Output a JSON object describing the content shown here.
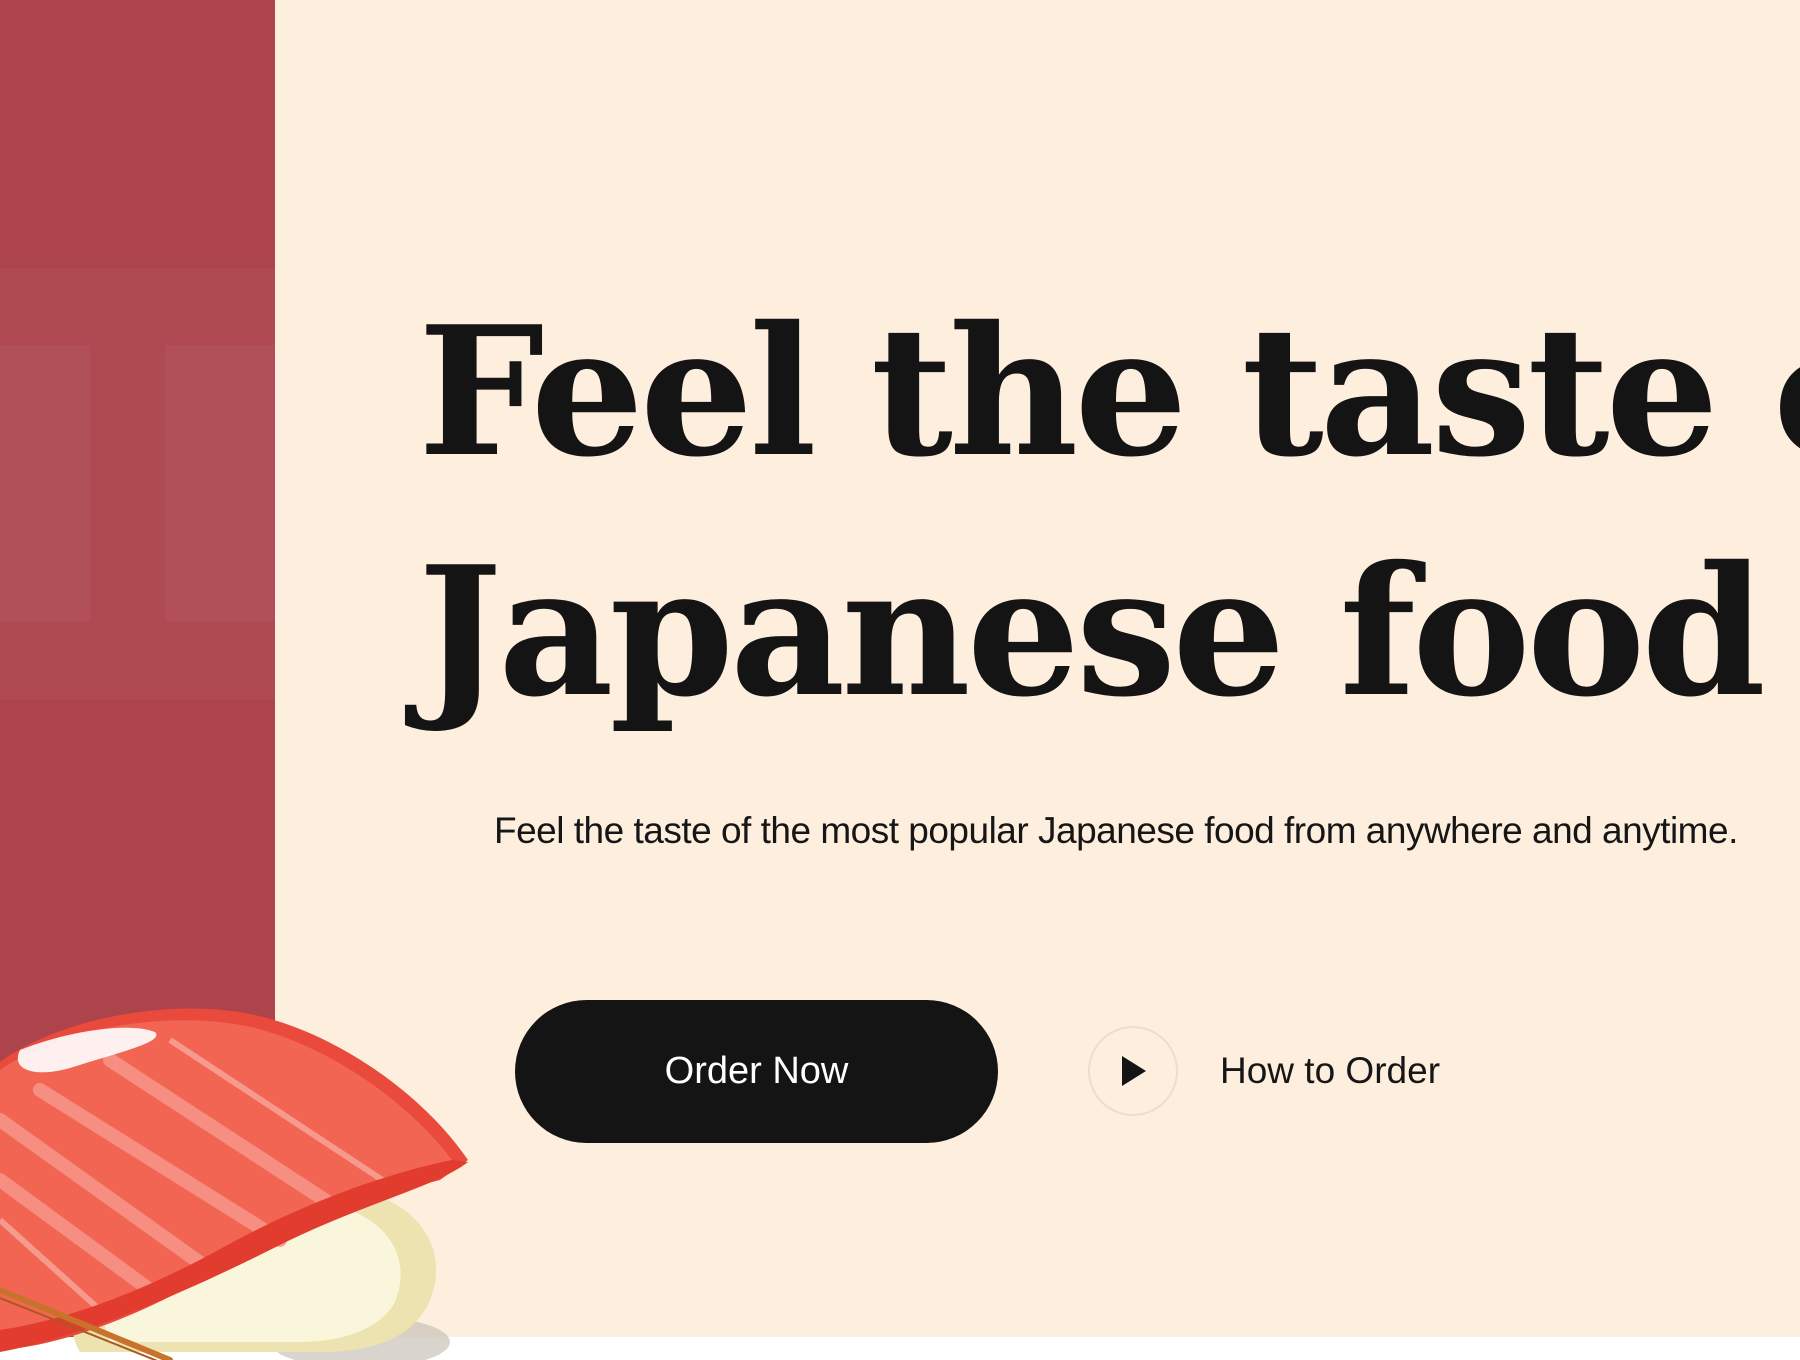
{
  "hero": {
    "headline_line1": "Feel the taste of",
    "headline_line2": "Japanese food",
    "subtitle": "Feel the taste of the most popular Japanese food from anywhere and anytime.",
    "primary_button": "Order Now",
    "secondary_link": "How to Order"
  },
  "icons": {
    "play": "play-icon",
    "illustration": "sushi-illustration"
  },
  "colors": {
    "background": "#fdeede",
    "side_panel": "#ad444c",
    "text": "#141414",
    "button": "#141414",
    "button_text": "#ffffff",
    "tuna": "#f05a4a"
  }
}
